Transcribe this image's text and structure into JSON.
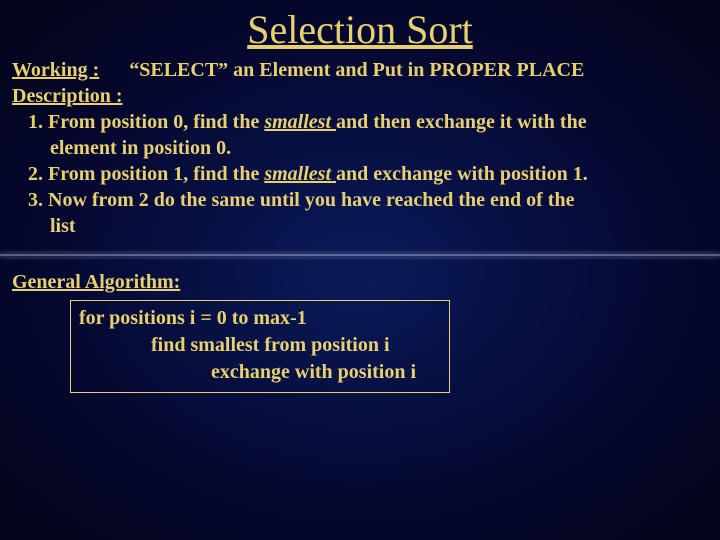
{
  "title": "Selection Sort",
  "working": {
    "label": "Working :",
    "text": "“SELECT” an Element and Put in PROPER PLACE"
  },
  "description": {
    "label": "Description :",
    "items": [
      {
        "prefix": "1. From position 0, find the ",
        "em": "smallest ",
        "mid": "and then exchange it with the",
        "cont": "element in position 0."
      },
      {
        "prefix": "2. From position 1, find the ",
        "em": "smallest ",
        "mid": "and exchange with position 1.",
        "cont": ""
      },
      {
        "prefix": "3. Now from 2 do the same until you have reached the end of the",
        "em": "",
        "mid": "",
        "cont": "list"
      }
    ]
  },
  "general": {
    "label": "General Algorithm:",
    "lines": [
      "for positions i = 0 to max-1",
      "find smallest from position i",
      "exchange with position i"
    ]
  }
}
